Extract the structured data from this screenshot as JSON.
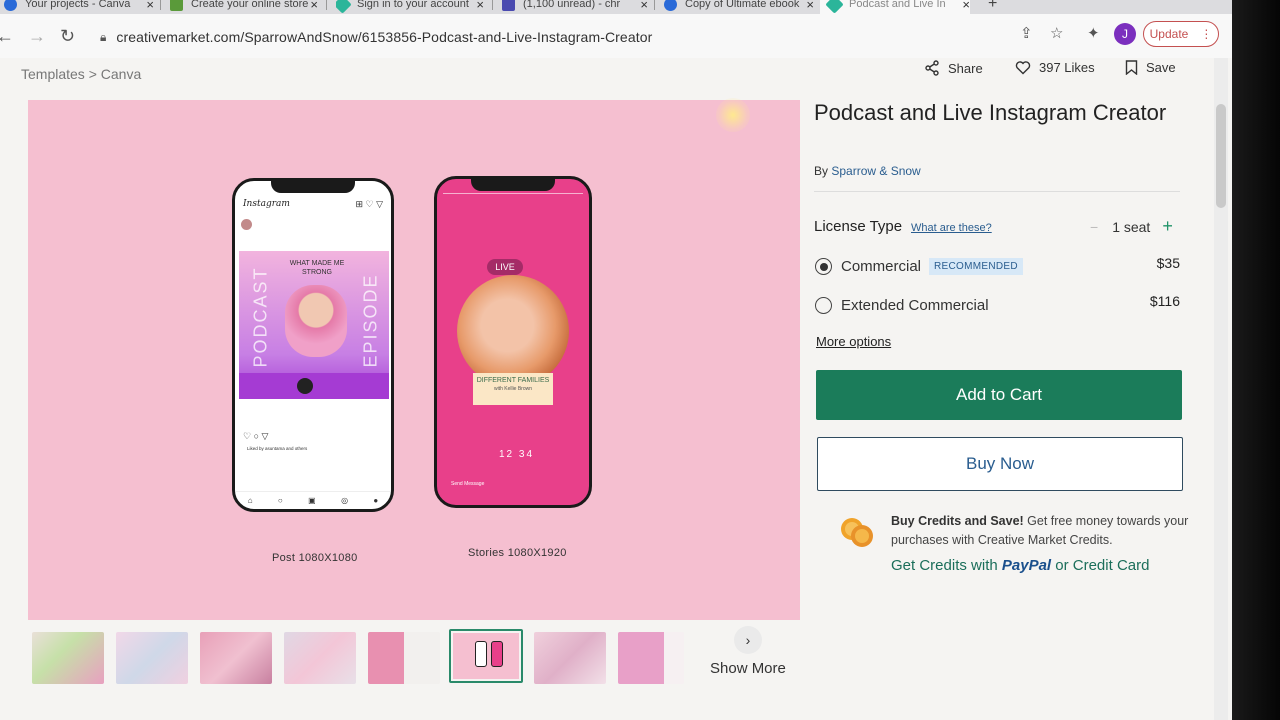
{
  "tabs": [
    {
      "label": "Your projects - Canva",
      "color": "#2a6ad8"
    },
    {
      "label": "Create your online store",
      "color": "#5a9a3a"
    },
    {
      "label": "Sign in to your account",
      "color": "#2bb59a"
    },
    {
      "label": "(1,100 unread) - chr",
      "color": "#4a4ab0"
    },
    {
      "label": "Copy of Ultimate ebook",
      "color": "#2a6ad8"
    },
    {
      "label": "Podcast and Live In",
      "color": "#2bb59a"
    }
  ],
  "address": {
    "url": "creativemarket.com/SparrowAndSnow/6153856-Podcast-and-Live-Instagram-Creator",
    "update_label": "Update",
    "profile_initial": "J"
  },
  "breadcrumb": "Templates > Canva",
  "actions": {
    "share": "Share",
    "likes": "397 Likes",
    "save": "Save"
  },
  "preview": {
    "post_caption": "Post  1080X1080",
    "stories_caption": "Stories  1080X1920",
    "post_brand": "Instagram",
    "post_title": "WHAT MADE ME STRONG",
    "post_left_vertical": "PODCAST",
    "post_right_vertical": "EPISODE",
    "liked_text": "Liked by asuntama and others",
    "story_live": "LIVE",
    "story_title": "DIFFERENT FAMILIES",
    "story_subtitle": "with Kellie Brown",
    "story_timer": "12 34",
    "story_message": "Send Message"
  },
  "product": {
    "title": "Podcast and Live Instagram Creator",
    "by_prefix": "By ",
    "author": "Sparrow & Snow",
    "license_label": "License Type",
    "license_link": "What are these?",
    "seat_count": "1 seat",
    "options": [
      {
        "label": "Commercial",
        "badge": "RECOMMENDED",
        "price": "$35",
        "selected": true
      },
      {
        "label": "Extended Commercial",
        "badge": "",
        "price": "$116",
        "selected": false
      }
    ],
    "more_options": "More options",
    "add_to_cart": "Add to Cart",
    "buy_now": "Buy Now",
    "credits_bold": "Buy Credits and Save!",
    "credits_text": " Get free money towards your purchases with Creative Market Credits.",
    "credits_link_prefix": "Get Credits with ",
    "credits_paypal": "PayPal",
    "credits_link_suffix": " or Credit Card"
  },
  "thumbnails": {
    "count": 8,
    "selected_index": 5,
    "show_more": "Show More"
  },
  "colors": {
    "accent_green": "#1b7c5a",
    "link_blue": "#2a5d8f",
    "preview_pink": "#f5bfd0",
    "story_pink": "#e8408a"
  }
}
